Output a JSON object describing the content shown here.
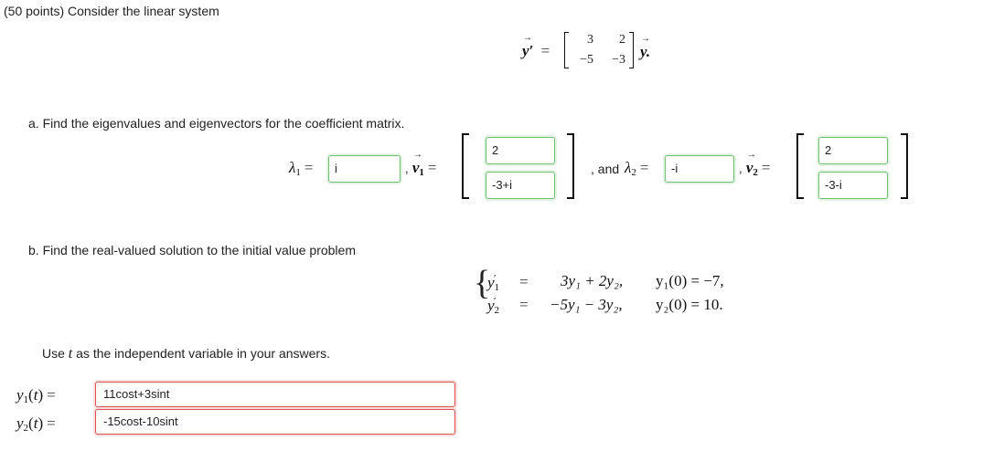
{
  "question": {
    "header": "(50 points) Consider the linear system",
    "system_lhs": "y′",
    "matrix": [
      "3",
      "2",
      "−5",
      "−3"
    ],
    "system_rhs": "y.",
    "part_a": {
      "prompt": "a. Find the eigenvalues and eigenvectors for the coefficient matrix.",
      "lambda1_value": "i",
      "v1": [
        "2",
        "-3+i"
      ],
      "and_text": ", and",
      "lambda2_value": "-i",
      "v2": [
        "2",
        "-3-i"
      ]
    },
    "part_b": {
      "prompt": "b. Find the real-valued solution to the initial value problem",
      "eq1_rhs": "3y₁ + 2y₂,",
      "eq2_rhs": "−5y₁ − 3y₂,",
      "ic1": "y₁(0) = −7,",
      "ic2": "y₂(0) = 10.",
      "use_prefix": "Use",
      "use_var": "t",
      "use_suffix": "as the independent variable in your answers.",
      "y1_answer": "11cost+3sint",
      "y2_answer": "-15cost-10sint"
    }
  },
  "colors": {
    "correct_border": "#6fbf73",
    "incorrect_border": "#d9534f"
  }
}
